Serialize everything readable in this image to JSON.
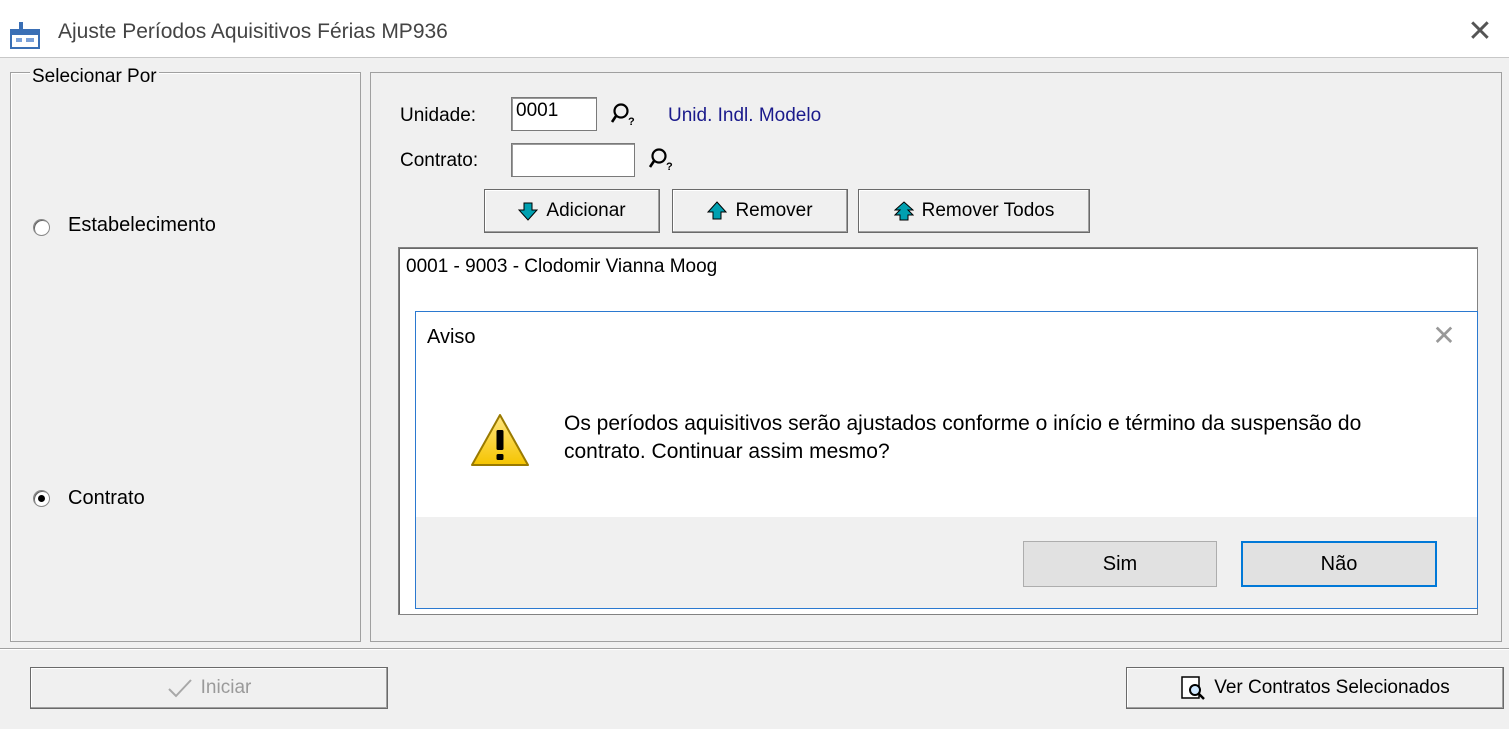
{
  "window": {
    "title": "Ajuste Períodos Aquisitivos Férias MP936",
    "close_glyph": "✕"
  },
  "select_by": {
    "legend": "Selecionar Por",
    "options": [
      {
        "label": "Estabelecimento",
        "checked": false
      },
      {
        "label": "Contrato",
        "checked": true
      }
    ]
  },
  "fields": {
    "unidade_label": "Unidade:",
    "unidade_value": "0001",
    "unidade_description": "Unid. Indl. Modelo",
    "contrato_label": "Contrato:",
    "contrato_value": ""
  },
  "actions": {
    "adicionar": "Adicionar",
    "remover": "Remover",
    "remover_todos": "Remover Todos"
  },
  "list": {
    "items": [
      "0001 - 9003 - Clodomir Vianna Moog"
    ]
  },
  "dialog": {
    "title": "Aviso",
    "close_glyph": "✕",
    "message": "Os períodos aquisitivos serão ajustados conforme o início e término da suspensão do contrato. Continuar assim mesmo?",
    "yes": "Sim",
    "no": "Não"
  },
  "footer": {
    "iniciar": "Iniciar",
    "ver_contratos": "Ver Contratos Selecionados"
  },
  "icons": {
    "app": "app-window-icon",
    "search": "magnifier-icon",
    "add": "arrow-down-icon",
    "remove": "arrow-up-icon",
    "remove_all": "double-arrow-up-icon",
    "warning": "warning-triangle-icon",
    "check": "checkmark-icon",
    "view": "document-search-icon"
  },
  "colors": {
    "arrow": "#00a0b0",
    "link_text": "#1a1a8c",
    "dialog_border": "#2b79d0",
    "focus": "#0078d7",
    "warning": "#f5c400"
  }
}
